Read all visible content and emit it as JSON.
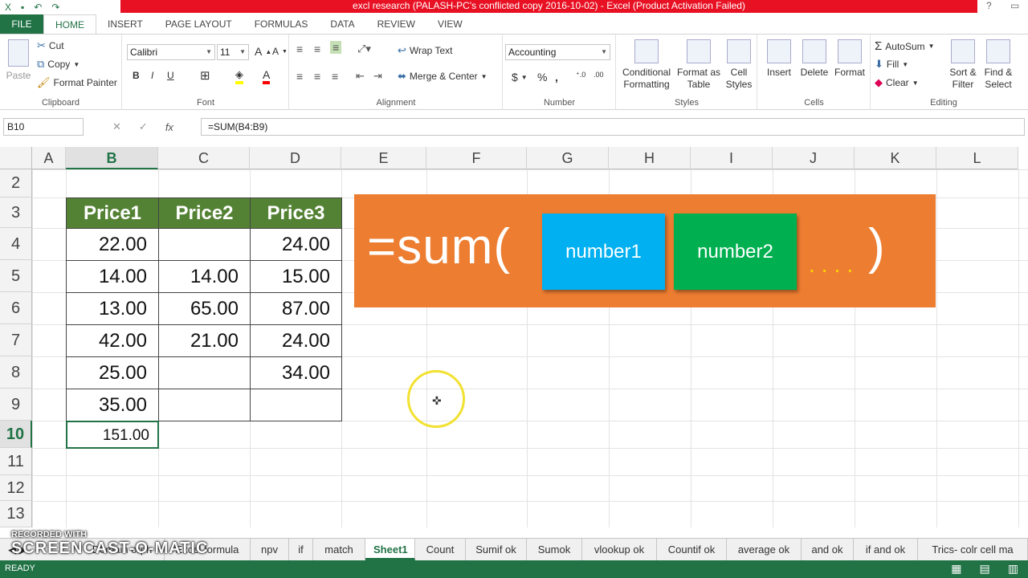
{
  "window": {
    "title": "excl research (PALASH-PC's conflicted copy 2016-10-02) -  Excel (Product Activation Failed)"
  },
  "ribbon_tabs": [
    "FILE",
    "HOME",
    "INSERT",
    "PAGE LAYOUT",
    "FORMULAS",
    "DATA",
    "REVIEW",
    "VIEW"
  ],
  "active_tab": "HOME",
  "ribbon": {
    "clipboard": {
      "paste": "Paste",
      "cut": "Cut",
      "copy": "Copy",
      "format_painter": "Format Painter",
      "label": "Clipboard"
    },
    "font": {
      "name": "Calibri",
      "size": "11",
      "bold": "B",
      "italic": "I",
      "underline": "U",
      "label": "Font"
    },
    "alignment": {
      "wrap_text": "Wrap Text",
      "merge_center": "Merge & Center",
      "label": "Alignment"
    },
    "number": {
      "format": "Accounting",
      "label": "Number",
      "dollar": "$",
      "percent": "%",
      "comma": ","
    },
    "styles": {
      "conditional": "Conditional Formatting",
      "format_table": "Format as Table",
      "cell_styles": "Cell Styles",
      "label": "Styles"
    },
    "cells": {
      "insert": "Insert",
      "delete": "Delete",
      "format": "Format",
      "label": "Cells"
    },
    "editing": {
      "autosum": "AutoSum",
      "fill": "Fill",
      "clear": "Clear",
      "sort_filter": "Sort & Filter",
      "find_select": "Find & Select",
      "label": "Editing"
    }
  },
  "formula_bar": {
    "name_box": "B10",
    "formula": "=SUM(B4:B9)",
    "fx": "fx"
  },
  "columns": [
    "A",
    "B",
    "C",
    "D",
    "E",
    "F",
    "G",
    "H",
    "I",
    "J",
    "K",
    "L"
  ],
  "selected_column": "B",
  "rows": [
    "2",
    "3",
    "4",
    "5",
    "6",
    "7",
    "8",
    "9",
    "10",
    "11",
    "12",
    "13"
  ],
  "selected_row": "10",
  "table": {
    "headers": [
      "Price1",
      "Price2",
      "Price3"
    ],
    "data": [
      [
        "22.00",
        "",
        "24.00"
      ],
      [
        "14.00",
        "14.00",
        "15.00"
      ],
      [
        "13.00",
        "65.00",
        "87.00"
      ],
      [
        "42.00",
        "21.00",
        "24.00"
      ],
      [
        "25.00",
        "",
        "34.00"
      ],
      [
        "35.00",
        "",
        ""
      ]
    ],
    "total": "151.00"
  },
  "banner": {
    "function": "=sum(",
    "arg1": "number1",
    "arg2": "number2",
    "more": "....",
    "close": ")",
    "colors": {
      "background": "#ed7d31",
      "arg1": "#00b0f0",
      "arg2": "#00b050"
    }
  },
  "sheet_tabs": [
    "Domain orph",
    "Excel formula",
    "npv",
    "if",
    "match",
    "Sheet1",
    "Count",
    "Sumif ok",
    "Sumok",
    "vlookup ok",
    "Countif ok",
    "average ok",
    "and ok",
    "if and ok",
    "Trics- colr cell ma"
  ],
  "active_sheet": "Sheet1",
  "watermark": {
    "line1": "RECORDED WITH",
    "line2": "SCREENCAST-O-MATIC"
  },
  "status": "READY"
}
